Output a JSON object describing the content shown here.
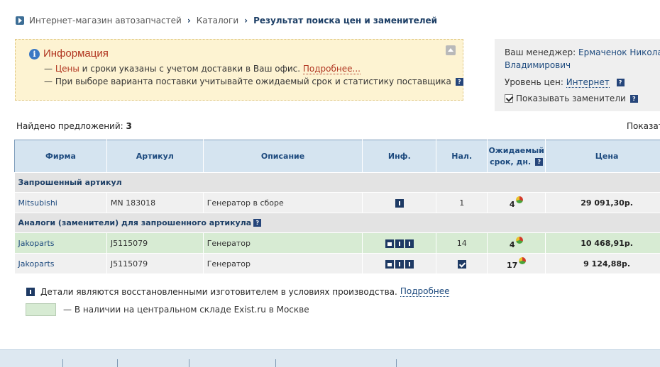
{
  "breadcrumb": {
    "items": [
      {
        "label": "Интернет-магазин автозапчастей"
      },
      {
        "label": "Каталоги"
      },
      {
        "label": "Результат поиска цен и заменителей"
      }
    ],
    "separator": "›"
  },
  "info": {
    "title": "Информация",
    "line1_prefix": "— ",
    "line1_highlight": "Цены",
    "line1_text": " и сроки указаны с учетом доставки в Ваш офис. ",
    "line1_link": "Подробнее...",
    "line2": "— При выборе варианта поставки учитывайте ожидаемый срок и статистику поставщика",
    "help_glyph": "?"
  },
  "manager": {
    "label": "Ваш менеджер:",
    "name_part1": "Ермаченок Николай",
    "name_part2": "Владимирович",
    "price_level_label": "Уровень цен:",
    "price_level_value": "Интернет",
    "show_substitutes_label": "Показывать заменители",
    "show_substitutes_checked": true
  },
  "summary": {
    "found_label": "Найдено предложений:",
    "found_count": "3",
    "show_label": "Показат"
  },
  "table": {
    "headers": {
      "brand": "Фирма",
      "article": "Артикул",
      "description": "Описание",
      "info": "Инф.",
      "availability": "Нал.",
      "term_line1": "Ожидаемый",
      "term_line2": "срок, дн.",
      "price": "Цена"
    },
    "section_requested": "Запрошенный артикул",
    "section_analogs": "Аналоги (заменители) для запрошенного артикула",
    "rows": [
      {
        "brand": "Mitsubishi",
        "article": "MN 183018",
        "description": "Генератор в сборе",
        "availability": "1",
        "term": "4",
        "price": "29 091,30р."
      },
      {
        "brand": "Jakoparts",
        "article": "J5115079",
        "description": "Генератор",
        "availability": "14",
        "term": "4",
        "price": "10 468,91р."
      },
      {
        "brand": "Jakoparts",
        "article": "J5115079",
        "description": "Генератор",
        "availability": "",
        "term": "17",
        "price": "9 124,88р."
      }
    ]
  },
  "legend": {
    "restored_text": "Детали являются восстановленными изготовителем в условиях производства.",
    "restored_link": "Подробнее",
    "stock_text": "— В наличии на центральном складе Exist.ru в Москве"
  },
  "colors": {
    "accent_blue": "#1d4a7e",
    "header_bg": "#d5e4f0",
    "stock_green": "#d7ebd3",
    "info_bg": "#fdf3d2",
    "info_title": "#b0341f"
  }
}
